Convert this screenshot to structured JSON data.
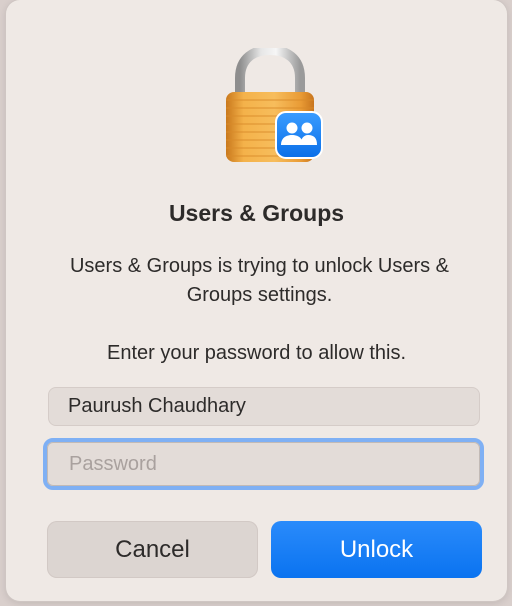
{
  "dialog": {
    "icon": "lock-with-users-badge-icon",
    "title": "Users & Groups",
    "message": "Users & Groups is trying to unlock Users & Groups settings.",
    "prompt": "Enter your password to allow this.",
    "username_value": "Paurush Chaudhary",
    "password_placeholder": "Password",
    "cancel_label": "Cancel",
    "unlock_label": "Unlock"
  },
  "colors": {
    "accent": "#0a73f0",
    "focus_ring": "#7fb0f4",
    "dialog_background": "#efe9e5",
    "lock_gold": "#f0a83a"
  }
}
